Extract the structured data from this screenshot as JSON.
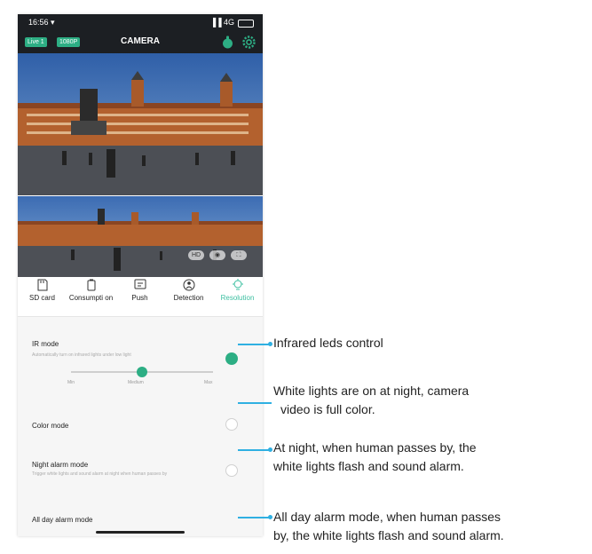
{
  "status_bar": {
    "time": "16:56 ▾",
    "network": "▐▐ 4G"
  },
  "header": {
    "badge_live": "Live 1",
    "badge_quality": "1080P",
    "title": "CAMERA"
  },
  "video_controls": [
    "HD",
    "◉",
    "⛶"
  ],
  "tabs": [
    {
      "label": "SD card",
      "icon": "sd-card-icon"
    },
    {
      "label": "Consumpti on",
      "icon": "battery-icon"
    },
    {
      "label": "Push",
      "icon": "message-icon"
    },
    {
      "label": "Detection",
      "icon": "detection-icon"
    },
    {
      "label": "Resolution",
      "icon": "lightbulb-icon",
      "active": true
    }
  ],
  "settings": {
    "ir_mode": {
      "title": "IR mode",
      "desc": "Automatically turn on infrared lights under low light",
      "selected": true
    },
    "slider": {
      "labels": [
        "Min",
        "Medium",
        "Max"
      ],
      "level": 0.5
    },
    "color_mode": {
      "title": "Color mode"
    },
    "night_alarm": {
      "title": "Night alarm mode",
      "desc": "Trigger white lights and sound alarm at night when human passes by"
    },
    "all_day_alarm": {
      "title": "All day alarm mode"
    }
  },
  "annotations": [
    {
      "lines": [
        "Infrared leds control"
      ]
    },
    {
      "lines": [
        "White lights are on at night, camera",
        "video is full color."
      ]
    },
    {
      "lines": [
        "At night, when human passes by, the",
        "white lights flash and sound alarm."
      ]
    },
    {
      "lines": [
        "All day alarm mode, when human passes",
        "by, the white lights flash and sound alarm."
      ]
    }
  ],
  "colors": {
    "accent": "#2dae84",
    "annotation": "#2fb0e2",
    "dark_bar": "#1c1f23"
  }
}
